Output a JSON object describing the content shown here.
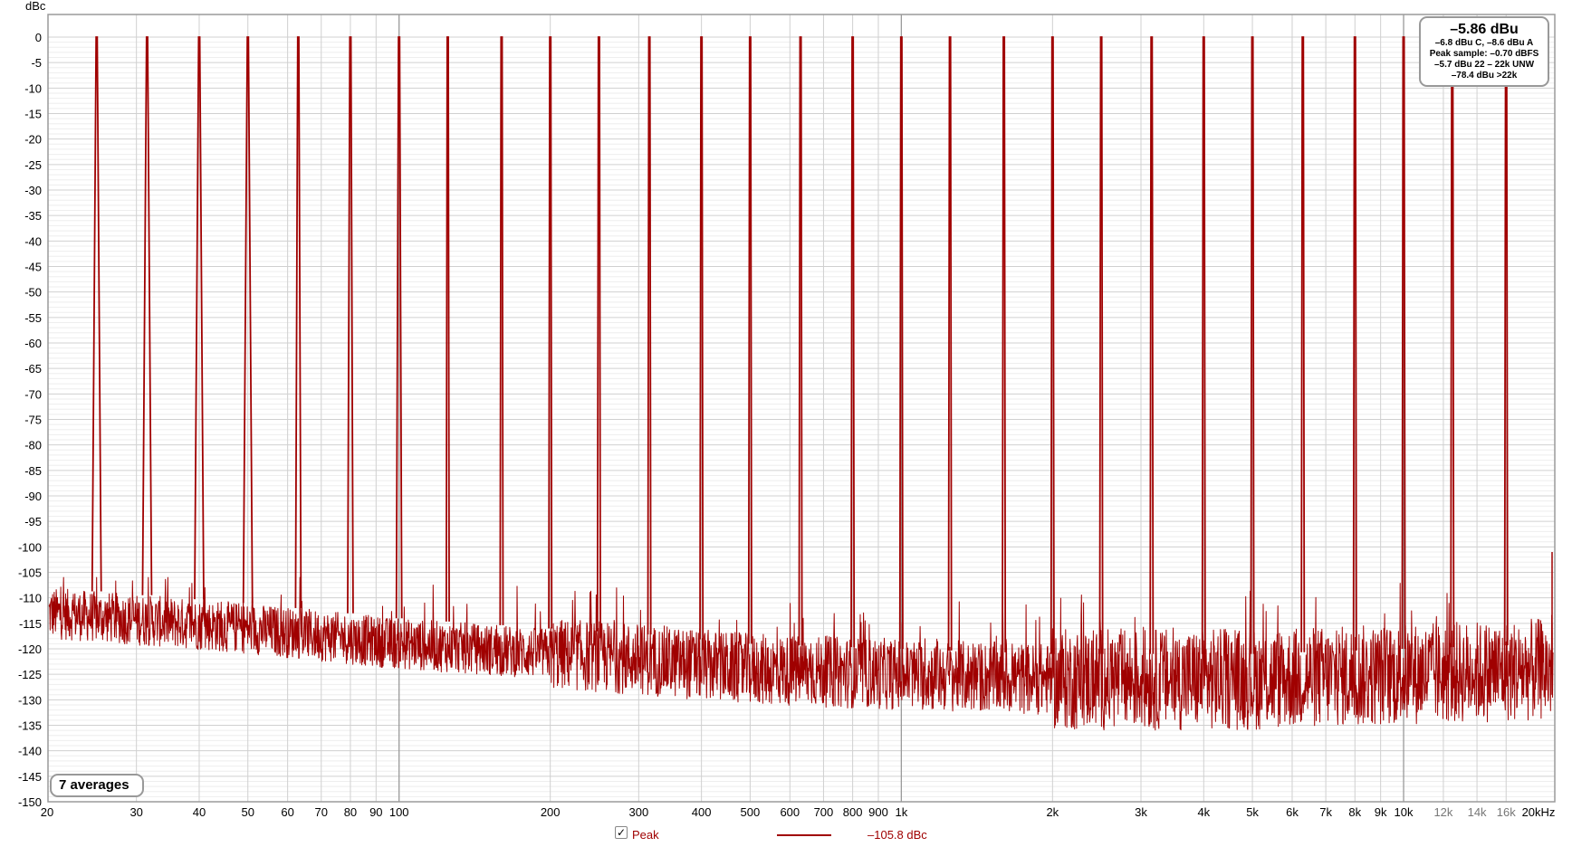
{
  "chart_data": {
    "type": "line",
    "ylabel": "dBc",
    "xscale": "log",
    "xlim": [
      20,
      20000
    ],
    "ylim": [
      -150,
      0
    ],
    "grid": true,
    "y_ticks": [
      0,
      -5,
      -10,
      -15,
      -20,
      -25,
      -30,
      -35,
      -40,
      -45,
      -50,
      -55,
      -60,
      -65,
      -70,
      -75,
      -80,
      -85,
      -90,
      -95,
      -100,
      -105,
      -110,
      -115,
      -120,
      -125,
      -130,
      -135,
      -140,
      -145,
      -150
    ],
    "x_ticks": [
      {
        "value": 20,
        "label": "20"
      },
      {
        "value": 30,
        "label": "30"
      },
      {
        "value": 40,
        "label": "40"
      },
      {
        "value": 50,
        "label": "50"
      },
      {
        "value": 60,
        "label": "60"
      },
      {
        "value": 70,
        "label": "70"
      },
      {
        "value": 80,
        "label": "80"
      },
      {
        "value": 90,
        "label": "90"
      },
      {
        "value": 100,
        "label": "100"
      },
      {
        "value": 200,
        "label": "200"
      },
      {
        "value": 300,
        "label": "300"
      },
      {
        "value": 400,
        "label": "400"
      },
      {
        "value": 500,
        "label": "500"
      },
      {
        "value": 600,
        "label": "600"
      },
      {
        "value": 700,
        "label": "700"
      },
      {
        "value": 800,
        "label": "800"
      },
      {
        "value": 900,
        "label": "900"
      },
      {
        "value": 1000,
        "label": "1k"
      },
      {
        "value": 2000,
        "label": "2k"
      },
      {
        "value": 3000,
        "label": "3k"
      },
      {
        "value": 4000,
        "label": "4k"
      },
      {
        "value": 5000,
        "label": "5k"
      },
      {
        "value": 6000,
        "label": "6k"
      },
      {
        "value": 7000,
        "label": "7k"
      },
      {
        "value": 8000,
        "label": "8k"
      },
      {
        "value": 9000,
        "label": "9k"
      },
      {
        "value": 10000,
        "label": "10k"
      },
      {
        "value": 12000,
        "label": "12k",
        "faint": true
      },
      {
        "value": 14000,
        "label": "14k",
        "faint": true
      },
      {
        "value": 16000,
        "label": "16k",
        "faint": true
      },
      {
        "value": 20000,
        "label": "20kHz"
      }
    ],
    "series": [
      {
        "name": "Peak",
        "color": "#a00000",
        "tones_hz": [
          25,
          31.5,
          40,
          50,
          63,
          80,
          100,
          125,
          160,
          200,
          250,
          315,
          400,
          500,
          630,
          800,
          1000,
          1250,
          1600,
          2000,
          2500,
          3150,
          4000,
          5000,
          6300,
          8000,
          10000,
          12500,
          16000
        ],
        "tone_level_dbc": 0,
        "noise_floor_dbc": [
          {
            "x": 20,
            "y": -113
          },
          {
            "x": 50,
            "y": -116
          },
          {
            "x": 100,
            "y": -119
          },
          {
            "x": 200,
            "y": -121
          },
          {
            "x": 300,
            "y": -122
          },
          {
            "x": 500,
            "y": -124
          },
          {
            "x": 1000,
            "y": -125
          },
          {
            "x": 2000,
            "y": -126
          },
          {
            "x": 5000,
            "y": -126
          },
          {
            "x": 10000,
            "y": -125
          },
          {
            "x": 20000,
            "y": -124
          }
        ]
      }
    ]
  },
  "info_box": {
    "main": "–5.86 dBu",
    "line1": "–6.8 dBu C, –8.6 dBu A",
    "line2": "Peak sample: –0.70 dBFS",
    "line3": "–5.7 dBu 22 – 22k UNW",
    "line4": "–78.4 dBu >22k"
  },
  "averages_label": "7 averages",
  "legend": {
    "checkbox_mark": "✓",
    "series_label": "Peak",
    "value_label": "–105.8 dBc"
  }
}
